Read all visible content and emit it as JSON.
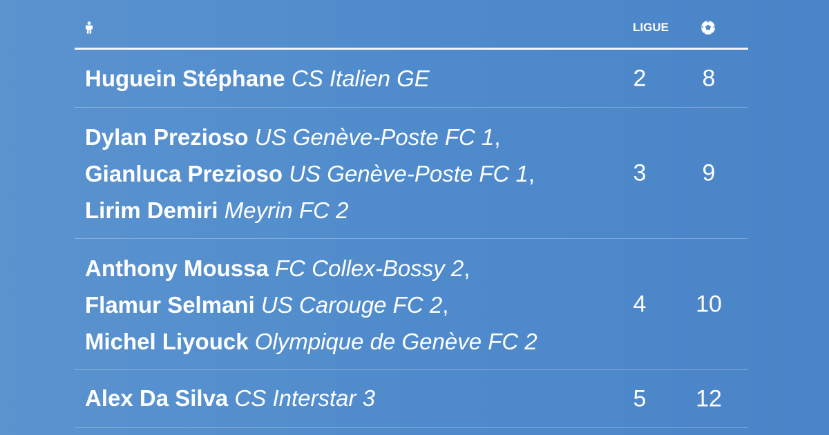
{
  "header": {
    "player_icon": "person-icon",
    "league_label": "LIGUE",
    "goals_icon": "soccer-ball-icon"
  },
  "rows": [
    {
      "players": [
        {
          "name": "Huguein Stéphane",
          "club": "CS Italien GE",
          "sep": ""
        }
      ],
      "league": "2",
      "goals": "8"
    },
    {
      "players": [
        {
          "name": "Dylan Prezioso",
          "club": "US Genève-Poste FC 1",
          "sep": ","
        },
        {
          "name": "Gianluca Prezioso",
          "club": "US Genève-Poste FC 1",
          "sep": ","
        },
        {
          "name": "Lirim Demiri",
          "club": "Meyrin FC 2",
          "sep": ""
        }
      ],
      "league": "3",
      "goals": "9"
    },
    {
      "players": [
        {
          "name": "Anthony Moussa",
          "club": "FC Collex-Bossy 2",
          "sep": ","
        },
        {
          "name": "Flamur Selmani",
          "club": "US Carouge FC 2",
          "sep": ","
        },
        {
          "name": "Michel Liyouck",
          "club": "Olympique de Genève FC 2",
          "sep": ""
        }
      ],
      "league": "4",
      "goals": "10"
    },
    {
      "players": [
        {
          "name": "Alex Da Silva",
          "club": "CS Interstar 3",
          "sep": ""
        }
      ],
      "league": "5",
      "goals": "12"
    }
  ],
  "colors": {
    "background": "#4f8bcc",
    "text": "#ffffff"
  }
}
